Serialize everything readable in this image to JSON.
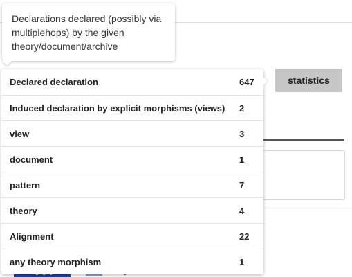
{
  "tooltip": {
    "text": "Declarations declared (possibly via multiplehops) by the given theory/document/archive"
  },
  "toolbar": {
    "statistics_label": "statistics"
  },
  "stats_table": {
    "rows": [
      {
        "label": "Declared declaration",
        "count": "647"
      },
      {
        "label": "Induced declaration by explicit morphisms (views)",
        "count": "2"
      },
      {
        "label": "view",
        "count": "3"
      },
      {
        "label": "document",
        "count": "1"
      },
      {
        "label": "pattern",
        "count": "7"
      },
      {
        "label": "theory",
        "count": "4"
      },
      {
        "label": "Alignment",
        "count": "22"
      },
      {
        "label": "any theory morphism",
        "count": "1"
      }
    ]
  },
  "colors": {
    "button_bg": "#c6c6c6",
    "divider": "#e2e2e2",
    "eu_flag_blue": "#1f3f99",
    "eu_flag_star": "#ffd400"
  }
}
